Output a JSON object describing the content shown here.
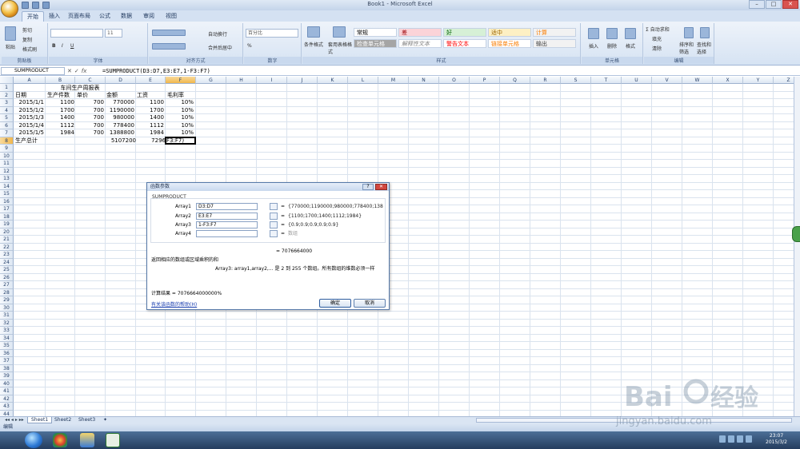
{
  "window": {
    "title": "Book1 - Microsoft Excel",
    "min": "–",
    "max": "□",
    "close": "✕"
  },
  "ribbon_tabs": [
    "开始",
    "插入",
    "页面布局",
    "公式",
    "数据",
    "审阅",
    "视图"
  ],
  "ribbon": {
    "paste": "粘贴",
    "cut": "剪切",
    "copy": "复制",
    "format_painter": "格式刷",
    "clipboard_group": "剪贴板",
    "font_size": "11",
    "font_group": "字体",
    "wrap_text": "自动换行",
    "merge_center": "合并后居中",
    "alignment_group": "对齐方式",
    "number_format": "百分比",
    "number_group": "数字",
    "conditional_format": "条件格式",
    "format_as_table": "套用表格格式",
    "styles": {
      "normal": "常规",
      "bad": "差",
      "good": "好",
      "neutral": "适中",
      "calculation": "计算",
      "check_cell": "检查单元格",
      "explanatory": "解释性文本",
      "warning": "警告文本",
      "linked_cell": "链接单元格",
      "output": "输出"
    },
    "styles_group": "样式",
    "insert": "插入",
    "delete": "删除",
    "format": "格式",
    "cells_group": "单元格",
    "autosum": "自动求和",
    "fill": "填充",
    "clear": "清除",
    "sort_filter": "排序和筛选",
    "find_select": "查找和选择",
    "editing_group": "编辑"
  },
  "formula_bar": {
    "name_box": "SUMPRODUCT",
    "cancel": "✕",
    "enter": "✓",
    "fx": "fx",
    "formula": "=SUMPRODUCT(D3:D7,E3:E7,1-F3:F7)"
  },
  "columns": [
    "A",
    "B",
    "C",
    "D",
    "E",
    "F",
    "G",
    "H",
    "I",
    "J",
    "K",
    "L",
    "M",
    "N",
    "O",
    "P",
    "Q",
    "R",
    "S",
    "T",
    "U",
    "V",
    "W",
    "X",
    "Y",
    "Z"
  ],
  "rows": [
    "1",
    "2",
    "3",
    "4",
    "5",
    "6",
    "7",
    "8",
    "9",
    "10",
    "11",
    "12",
    "13",
    "14",
    "15",
    "16",
    "17",
    "18",
    "19",
    "20",
    "21",
    "22",
    "23",
    "24",
    "25",
    "26",
    "27",
    "28",
    "29",
    "30",
    "31",
    "32",
    "33",
    "34",
    "35",
    "36",
    "37",
    "38",
    "39",
    "40",
    "41",
    "42",
    "43",
    "44",
    "45"
  ],
  "sheet": {
    "title": "车间生产周报表",
    "headers": [
      "日期",
      "生产件数",
      "单价",
      "金额",
      "工资",
      "毛利率"
    ],
    "rows": [
      [
        "2015/1/1",
        "1100",
        "700",
        "770000",
        "1100",
        "10%"
      ],
      [
        "2015/1/2",
        "1700",
        "700",
        "1190000",
        "1700",
        "10%"
      ],
      [
        "2015/1/3",
        "1400",
        "700",
        "980000",
        "1400",
        "10%"
      ],
      [
        "2015/1/4",
        "1112",
        "700",
        "778400",
        "1112",
        "10%"
      ],
      [
        "2015/1/5",
        "1984",
        "700",
        "1388800",
        "1984",
        "10%"
      ]
    ],
    "total_label": "生产总计",
    "total_amount": "5107200",
    "total_wage": "7296",
    "active_cell_text": "F3:F7)"
  },
  "dialog": {
    "title": "函数参数",
    "help": "?",
    "close": "✕",
    "function_name": "SUMPRODUCT",
    "args": [
      {
        "label": "Array1",
        "value": "D3:D7",
        "result": "{770000;1190000;980000;778400;138"
      },
      {
        "label": "Array2",
        "value": "E3:E7",
        "result": "{1100;1700;1400;1112;1984}"
      },
      {
        "label": "Array3",
        "value": "1-F3:F7",
        "result": "{0.9;0.9;0.9;0.9;0.9}"
      },
      {
        "label": "Array4",
        "value": "",
        "result": "数组"
      }
    ],
    "eq": "=",
    "result": "= 7076664000",
    "description": "返回相应的数组或区域乘积的和",
    "arg_description": "Array3:  array1,array2,... 是 2 到 255 个数组。所有数组的维数必须一样",
    "calc_result": "计算结果 = 7076664000000%",
    "help_link": "有关该函数的帮助(H)",
    "ok": "确定",
    "cancel": "取消"
  },
  "sheet_tabs": [
    "Sheet1",
    "Sheet2",
    "Sheet3"
  ],
  "status": "编辑",
  "clock": {
    "time": "23:07",
    "date": "2015/3/2"
  },
  "watermark": "jingyan.baidu.com"
}
